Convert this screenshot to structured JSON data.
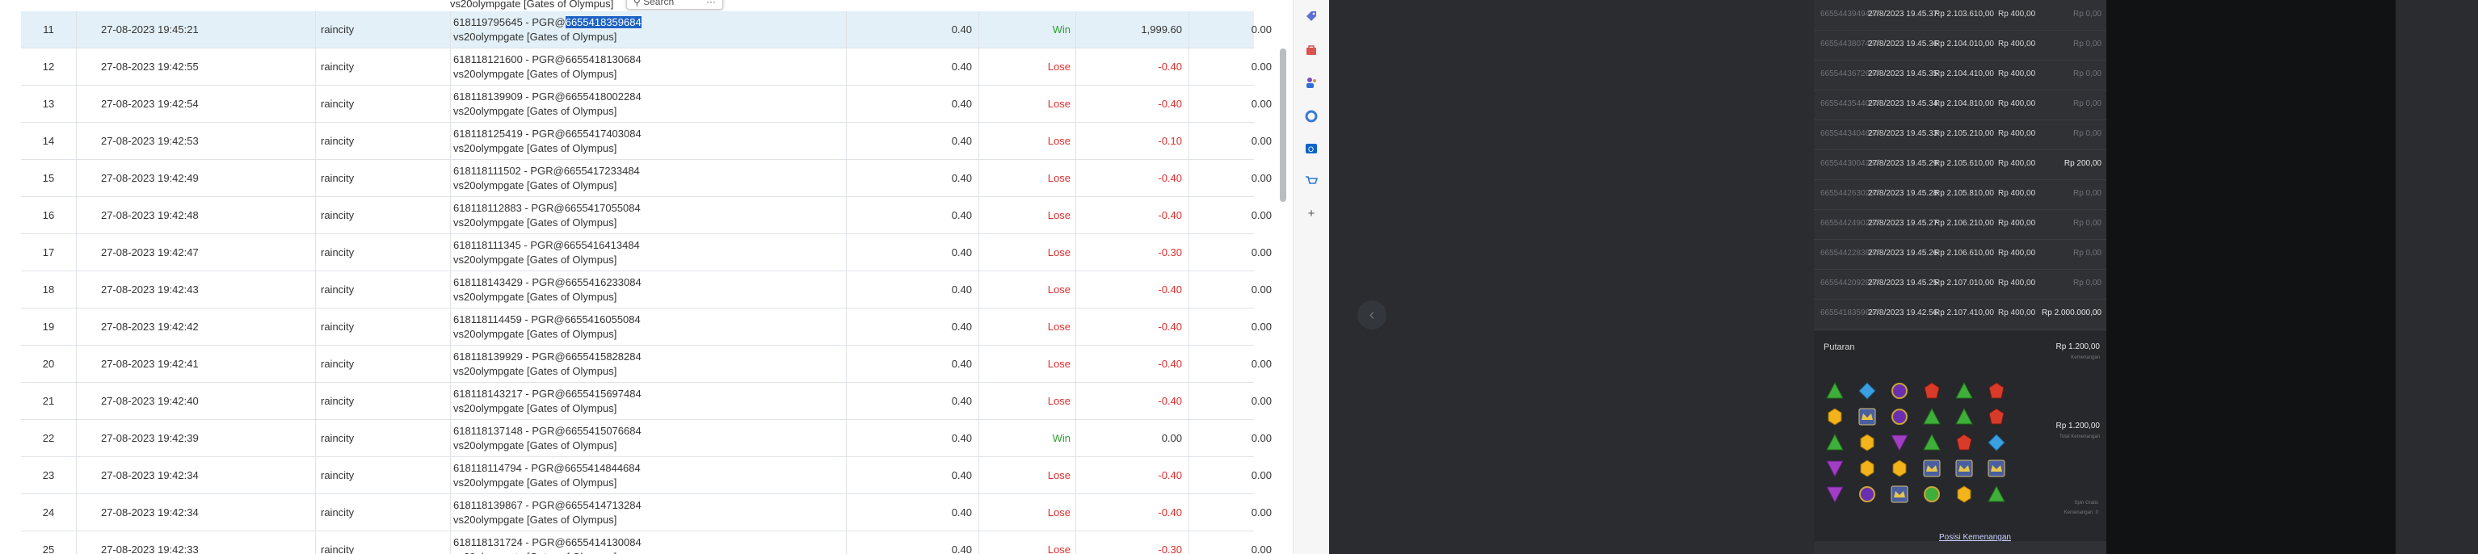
{
  "top_partial_text": "vs20olympgate [Gates of Olympus]",
  "search_popup": {
    "label": "Search",
    "more": "···"
  },
  "rows": [
    {
      "no": "11",
      "date": "27-08-2023 19:45:21",
      "user": "raincity",
      "game_prefix": "618119795645 - PGR@",
      "game_hl": "6655418359684",
      "game_suffix": "",
      "game_line2": "vs20olympgate [Gates of Olympus]",
      "bet": "0.40",
      "result": "Win",
      "win": "1,999.60",
      "jp": "0.00"
    },
    {
      "no": "12",
      "date": "27-08-2023 19:42:55",
      "user": "raincity",
      "game_prefix": "618118121600 - PGR@6655418130684",
      "game_hl": "",
      "game_suffix": "",
      "game_line2": "vs20olympgate [Gates of Olympus]",
      "bet": "0.40",
      "result": "Lose",
      "win": "-0.40",
      "jp": "0.00"
    },
    {
      "no": "13",
      "date": "27-08-2023 19:42:54",
      "user": "raincity",
      "game_prefix": "618118139909 - PGR@6655418002284",
      "game_hl": "",
      "game_suffix": "",
      "game_line2": "vs20olympgate [Gates of Olympus]",
      "bet": "0.40",
      "result": "Lose",
      "win": "-0.40",
      "jp": "0.00"
    },
    {
      "no": "14",
      "date": "27-08-2023 19:42:53",
      "user": "raincity",
      "game_prefix": "618118125419 - PGR@6655417403084",
      "game_hl": "",
      "game_suffix": "",
      "game_line2": "vs20olympgate [Gates of Olympus]",
      "bet": "0.40",
      "result": "Lose",
      "win": "-0.10",
      "jp": "0.00"
    },
    {
      "no": "15",
      "date": "27-08-2023 19:42:49",
      "user": "raincity",
      "game_prefix": "618118111502 - PGR@6655417233484",
      "game_hl": "",
      "game_suffix": "",
      "game_line2": "vs20olympgate [Gates of Olympus]",
      "bet": "0.40",
      "result": "Lose",
      "win": "-0.40",
      "jp": "0.00"
    },
    {
      "no": "16",
      "date": "27-08-2023 19:42:48",
      "user": "raincity",
      "game_prefix": "618118112883 - PGR@6655417055084",
      "game_hl": "",
      "game_suffix": "",
      "game_line2": "vs20olympgate [Gates of Olympus]",
      "bet": "0.40",
      "result": "Lose",
      "win": "-0.40",
      "jp": "0.00"
    },
    {
      "no": "17",
      "date": "27-08-2023 19:42:47",
      "user": "raincity",
      "game_prefix": "618118111345 - PGR@6655416413484",
      "game_hl": "",
      "game_suffix": "",
      "game_line2": "vs20olympgate [Gates of Olympus]",
      "bet": "0.40",
      "result": "Lose",
      "win": "-0.30",
      "jp": "0.00"
    },
    {
      "no": "18",
      "date": "27-08-2023 19:42:43",
      "user": "raincity",
      "game_prefix": "618118143429 - PGR@6655416233084",
      "game_hl": "",
      "game_suffix": "",
      "game_line2": "vs20olympgate [Gates of Olympus]",
      "bet": "0.40",
      "result": "Lose",
      "win": "-0.40",
      "jp": "0.00"
    },
    {
      "no": "19",
      "date": "27-08-2023 19:42:42",
      "user": "raincity",
      "game_prefix": "618118114459 - PGR@6655416055084",
      "game_hl": "",
      "game_suffix": "",
      "game_line2": "vs20olympgate [Gates of Olympus]",
      "bet": "0.40",
      "result": "Lose",
      "win": "-0.40",
      "jp": "0.00"
    },
    {
      "no": "20",
      "date": "27-08-2023 19:42:41",
      "user": "raincity",
      "game_prefix": "618118139929 - PGR@6655415828284",
      "game_hl": "",
      "game_suffix": "",
      "game_line2": "vs20olympgate [Gates of Olympus]",
      "bet": "0.40",
      "result": "Lose",
      "win": "-0.40",
      "jp": "0.00"
    },
    {
      "no": "21",
      "date": "27-08-2023 19:42:40",
      "user": "raincity",
      "game_prefix": "618118143217 - PGR@6655415697484",
      "game_hl": "",
      "game_suffix": "",
      "game_line2": "vs20olympgate [Gates of Olympus]",
      "bet": "0.40",
      "result": "Lose",
      "win": "-0.40",
      "jp": "0.00"
    },
    {
      "no": "22",
      "date": "27-08-2023 19:42:39",
      "user": "raincity",
      "game_prefix": "618118137148 - PGR@6655415076684",
      "game_hl": "",
      "game_suffix": "",
      "game_line2": "vs20olympgate [Gates of Olympus]",
      "bet": "0.40",
      "result": "Win",
      "win": "0.00",
      "jp": "0.00"
    },
    {
      "no": "23",
      "date": "27-08-2023 19:42:34",
      "user": "raincity",
      "game_prefix": "618118114794 - PGR@6655414844684",
      "game_hl": "",
      "game_suffix": "",
      "game_line2": "vs20olympgate [Gates of Olympus]",
      "bet": "0.40",
      "result": "Lose",
      "win": "-0.40",
      "jp": "0.00"
    },
    {
      "no": "24",
      "date": "27-08-2023 19:42:34",
      "user": "raincity",
      "game_prefix": "618118139867 - PGR@6655414713284",
      "game_hl": "",
      "game_suffix": "",
      "game_line2": "vs20olympgate [Gates of Olympus]",
      "bet": "0.40",
      "result": "Lose",
      "win": "-0.40",
      "jp": "0.00"
    },
    {
      "no": "25",
      "date": "27-08-2023 19:42:33",
      "user": "raincity",
      "game_prefix": "618118131724 - PGR@6655414130084",
      "game_hl": "",
      "game_suffix": "",
      "game_line2": "vs20olympgate [Gates of Olympus]",
      "bet": "0.40",
      "result": "Lose",
      "win": "-0.30",
      "jp": "0.00"
    }
  ],
  "toolbar_icons": [
    "tag-icon",
    "toolbox-icon",
    "people-icon",
    "copilot-icon",
    "outlook-icon",
    "shopping-icon",
    "add-icon"
  ],
  "toolbar_add_glyph": "+",
  "nav_glyph": "‹",
  "history": [
    {
      "id": "6655443949484",
      "date": "27/8/2023 19.45.37",
      "saldo": "Rp 2.103.610,00",
      "bet": "Rp 400,00",
      "win": "Rp 0,00"
    },
    {
      "id": "6655443807484",
      "date": "27/8/2023 19.45.36",
      "saldo": "Rp 2.104.010,00",
      "bet": "Rp 400,00",
      "win": "Rp 0,00"
    },
    {
      "id": "6655443672684",
      "date": "27/8/2023 19.45.35",
      "saldo": "Rp 2.104.410,00",
      "bet": "Rp 400,00",
      "win": "Rp 0,00"
    },
    {
      "id": "6655443544084",
      "date": "27/8/2023 19.45.34",
      "saldo": "Rp 2.104.810,00",
      "bet": "Rp 400,00",
      "win": "Rp 0,00"
    },
    {
      "id": "6655443404684",
      "date": "27/8/2023 19.45.33",
      "saldo": "Rp 2.105.210,00",
      "bet": "Rp 400,00",
      "win": "Rp 0,00"
    },
    {
      "id": "6655443004284",
      "date": "27/8/2023 19.45.29",
      "saldo": "Rp 2.105.610,00",
      "bet": "Rp 400,00",
      "win": "Rp 200,00"
    },
    {
      "id": "6655442630284",
      "date": "27/8/2023 19.45.28",
      "saldo": "Rp 2.105.810,00",
      "bet": "Rp 400,00",
      "win": "Rp 0,00"
    },
    {
      "id": "6655442490284",
      "date": "27/8/2023 19.45.27",
      "saldo": "Rp 2.106.210,00",
      "bet": "Rp 400,00",
      "win": "Rp 0,00"
    },
    {
      "id": "6655442283884",
      "date": "27/8/2023 19.45.26",
      "saldo": "Rp 2.106.610,00",
      "bet": "Rp 400,00",
      "win": "Rp 0,00"
    },
    {
      "id": "6655442092884",
      "date": "27/8/2023 19.45.25",
      "saldo": "Rp 2.107.010,00",
      "bet": "Rp 400,00",
      "win": "Rp 0,00"
    },
    {
      "id": "6655418359684",
      "date": "27/8/2023 19.42.56",
      "saldo": "Rp 2.107.410,00",
      "bet": "Rp 400,00",
      "win": "Rp 2.000.000,00"
    }
  ],
  "detail": {
    "putaran": "Putaran",
    "amount1": "Rp 1.200,00",
    "amount1_sub": "Kemenangan",
    "amount2": "Rp 1.200,00",
    "amount2_sub": "Total Kemenangan",
    "tiny1": "Spin Gratis",
    "tiny2": "Kemenangan: 0",
    "posisi": "Posisi Kemenangan"
  },
  "reel_grid": [
    [
      "green-tri",
      "blue-diamond",
      "purple-gem",
      "red-gem",
      "green-tri",
      "red-gem"
    ],
    [
      "yellow-gem",
      "crown",
      "purple-gem",
      "green-tri",
      "green-tri",
      "red-gem"
    ],
    [
      "green-tri",
      "yellow-gem",
      "purple-tri",
      "green-tri",
      "red-gem",
      "blue-diamond"
    ],
    [
      "purple-tri",
      "yellow-gem",
      "yellow-gem",
      "crown",
      "crown",
      "crown"
    ],
    [
      "purple-tri",
      "purple-gem",
      "crown",
      "green-gem",
      "yellow-gem",
      "green-tri"
    ]
  ],
  "colors": {
    "win": "#2e9e33",
    "lose": "#e02d2d",
    "highlight_row": "#e3f0f7",
    "selection": "#1e63c4",
    "dark_bg": "#1b1d20"
  }
}
